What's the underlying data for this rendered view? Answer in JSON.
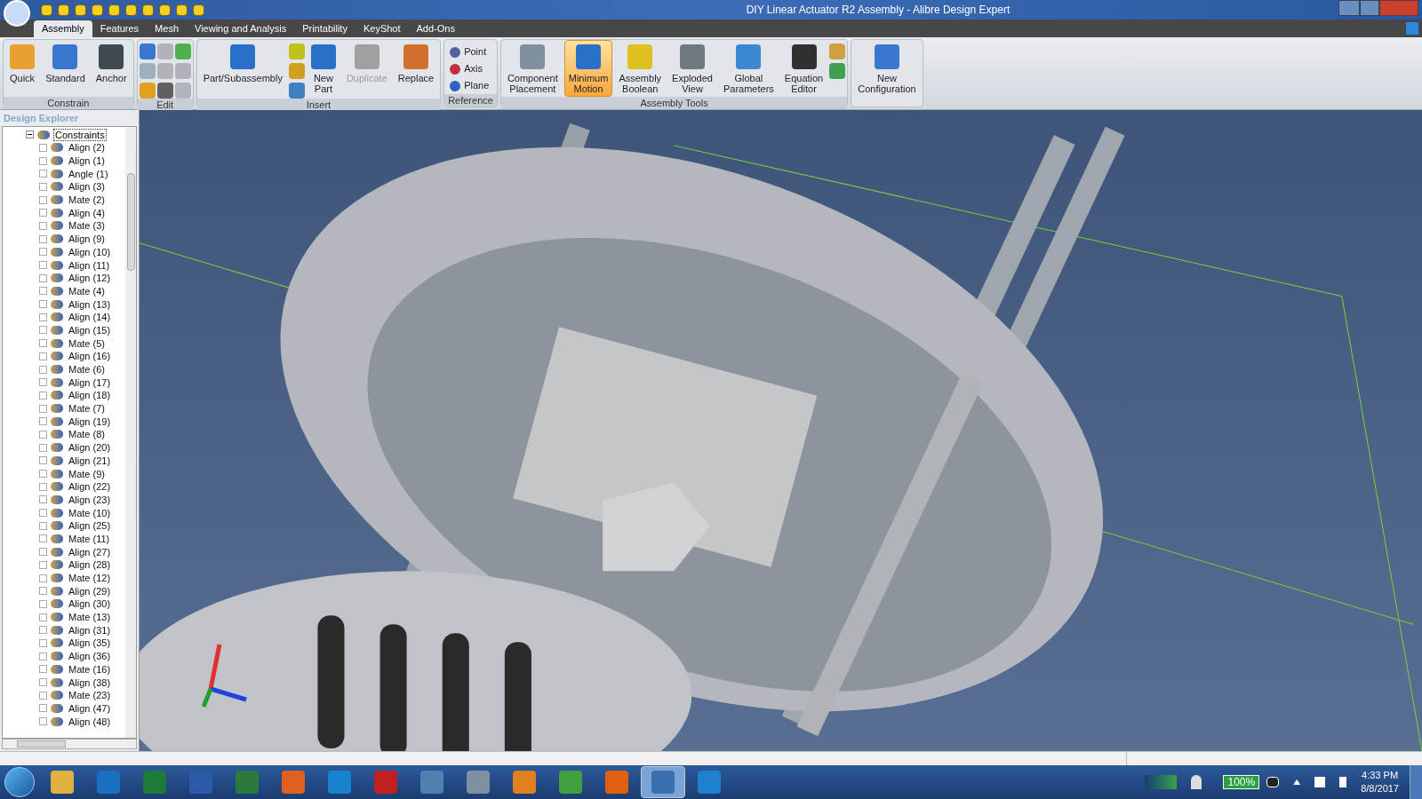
{
  "window": {
    "title": "DIY Linear Actuator R2 Assembly - Alibre Design Expert"
  },
  "tabs": [
    {
      "label": "Assembly",
      "selected": true
    },
    {
      "label": "Features",
      "selected": false
    },
    {
      "label": "Mesh",
      "selected": false
    },
    {
      "label": "Viewing and Analysis",
      "selected": false
    },
    {
      "label": "Printability",
      "selected": false
    },
    {
      "label": "KeyShot",
      "selected": false
    },
    {
      "label": "Add-Ons",
      "selected": false
    }
  ],
  "ribbon_groups": [
    {
      "title": "Constrain",
      "buttons": [
        {
          "kind": "large",
          "label": "Quick",
          "color": "#e8a030",
          "selected": false,
          "disabled": false
        },
        {
          "kind": "large",
          "label": "Standard",
          "color": "#3a78d0",
          "selected": false,
          "disabled": false
        },
        {
          "kind": "large",
          "label": "Anchor",
          "color": "#404850",
          "selected": false,
          "disabled": false
        }
      ]
    },
    {
      "title": "Edit",
      "buttons": [
        {
          "kind": "icon",
          "color": "#3a78d0"
        },
        {
          "kind": "icon",
          "color": "#a0b0c0"
        },
        {
          "kind": "icon",
          "color": "#e0a020"
        },
        {
          "kind": "icon",
          "color": "#b0b4b8"
        },
        {
          "kind": "icon",
          "color": "#b0b4b9"
        },
        {
          "kind": "icon",
          "color": "#606060"
        },
        {
          "kind": "icon",
          "color": "#50b050"
        },
        {
          "kind": "icon",
          "color": "#b0b4ba"
        },
        {
          "kind": "icon",
          "color": "#b0b4bb"
        }
      ]
    },
    {
      "title": "Insert",
      "buttons": [
        {
          "kind": "large",
          "label": "Part/Subassembly",
          "color": "#2a70c8",
          "selected": false,
          "disabled": false
        },
        {
          "kind": "icon",
          "color": "#c0c020"
        },
        {
          "kind": "icon",
          "color": "#d0a020"
        },
        {
          "kind": "icon",
          "color": "#4080c0"
        },
        {
          "kind": "large",
          "label": "New Part",
          "color": "#2a70c8",
          "selected": false,
          "disabled": false
        },
        {
          "kind": "large",
          "label": "Duplicate",
          "color": "#a0a0a0",
          "selected": false,
          "disabled": true
        },
        {
          "kind": "large",
          "label": "Replace",
          "color": "#d07030",
          "selected": false,
          "disabled": false
        }
      ]
    },
    {
      "title": "Reference",
      "buttons": [
        {
          "kind": "small",
          "label": "Point",
          "color": "#5060a0",
          "disabled": false
        },
        {
          "kind": "small",
          "label": "Axis",
          "color": "#c03040",
          "disabled": false
        },
        {
          "kind": "small",
          "label": "Plane",
          "color": "#3060c0",
          "disabled": false
        }
      ]
    },
    {
      "title": "Assembly Tools",
      "buttons": [
        {
          "kind": "large",
          "label": "Component Placement",
          "color": "#8090a0",
          "selected": false,
          "disabled": false
        },
        {
          "kind": "large",
          "label": "Minimum Motion",
          "color": "#2a70c8",
          "selected": true,
          "disabled": false
        },
        {
          "kind": "large",
          "label": "Assembly Boolean",
          "color": "#e0c020",
          "selected": false,
          "disabled": false
        },
        {
          "kind": "large",
          "label": "Exploded View",
          "color": "#707880",
          "selected": false,
          "disabled": false
        },
        {
          "kind": "large",
          "label": "Global Parameters",
          "color": "#3a88d0",
          "selected": false,
          "disabled": false
        },
        {
          "kind": "large",
          "label": "Equation Editor",
          "color": "#303030",
          "selected": false,
          "disabled": false
        },
        {
          "kind": "icon",
          "color": "#d0a040"
        },
        {
          "kind": "icon",
          "color": "#40a050"
        }
      ]
    },
    {
      "buttons": [
        {
          "kind": "large",
          "label": "New Configuration",
          "color": "#3a78d0",
          "selected": false,
          "disabled": false
        }
      ]
    }
  ],
  "design_explorer": {
    "title": "Design Explorer",
    "root": {
      "label": "Constraints",
      "selected": true,
      "expanded": true,
      "children": [
        {
          "label": "Align (2)",
          "selected": false
        },
        {
          "label": "Align (1)",
          "selected": false
        },
        {
          "label": "Angle (1)",
          "selected": false
        },
        {
          "label": "Align (3)",
          "selected": false
        },
        {
          "label": "Mate (2)",
          "selected": false
        },
        {
          "label": "Align (4)",
          "selected": false
        },
        {
          "label": "Mate (3)",
          "selected": false
        },
        {
          "label": "Align (9)",
          "selected": false
        },
        {
          "label": "Align (10)",
          "selected": false
        },
        {
          "label": "Align (11)",
          "selected": false
        },
        {
          "label": "Align (12)",
          "selected": false
        },
        {
          "label": "Mate (4)",
          "selected": false
        },
        {
          "label": "Align (13)",
          "selected": false
        },
        {
          "label": "Align (14)",
          "selected": false
        },
        {
          "label": "Align (15)",
          "selected": false
        },
        {
          "label": "Mate (5)",
          "selected": false
        },
        {
          "label": "Align (16)",
          "selected": false
        },
        {
          "label": "Mate (6)",
          "selected": false
        },
        {
          "label": "Align (17)",
          "selected": false
        },
        {
          "label": "Align (18)",
          "selected": false
        },
        {
          "label": "Mate (7)",
          "selected": false
        },
        {
          "label": "Align (19)",
          "selected": false
        },
        {
          "label": "Mate (8)",
          "selected": false
        },
        {
          "label": "Align (20)",
          "selected": false
        },
        {
          "label": "Align (21)",
          "selected": false
        },
        {
          "label": "Mate (9)",
          "selected": false
        },
        {
          "label": "Align (22)",
          "selected": false
        },
        {
          "label": "Align (23)",
          "selected": false
        },
        {
          "label": "Mate (10)",
          "selected": false
        },
        {
          "label": "Align (25)",
          "selected": false
        },
        {
          "label": "Mate (11)",
          "selected": false
        },
        {
          "label": "Align (27)",
          "selected": false
        },
        {
          "label": "Align (28)",
          "selected": false
        },
        {
          "label": "Mate (12)",
          "selected": false
        },
        {
          "label": "Align (29)",
          "selected": false
        },
        {
          "label": "Align (30)",
          "selected": false
        },
        {
          "label": "Mate (13)",
          "selected": false
        },
        {
          "label": "Align (31)",
          "selected": false
        },
        {
          "label": "Align (35)",
          "selected": false
        },
        {
          "label": "Align (36)",
          "selected": false
        },
        {
          "label": "Mate (16)",
          "selected": false
        },
        {
          "label": "Align (38)",
          "selected": false
        },
        {
          "label": "Mate (23)",
          "selected": false
        },
        {
          "label": "Align (47)",
          "selected": false
        },
        {
          "label": "Align (48)",
          "selected": false
        }
      ]
    }
  },
  "taskbar": {
    "apps": [
      {
        "color": "#e0b040",
        "selected": false
      },
      {
        "color": "#1a70c0",
        "selected": false
      },
      {
        "color": "#1d7a3a",
        "selected": false
      },
      {
        "color": "#2a5aa8",
        "selected": false
      },
      {
        "color": "#2a7a40",
        "selected": false
      },
      {
        "color": "#e06020",
        "selected": false
      },
      {
        "color": "#1a80d0",
        "selected": false
      },
      {
        "color": "#c02020",
        "selected": false
      },
      {
        "color": "#5080b0",
        "selected": false
      },
      {
        "color": "#8090a0",
        "selected": false
      },
      {
        "color": "#e08020",
        "selected": false
      },
      {
        "color": "#40a040",
        "selected": false
      },
      {
        "color": "#e06010",
        "selected": false
      },
      {
        "color": "#3a70b0",
        "selected": true
      },
      {
        "color": "#2080d0",
        "selected": false
      }
    ],
    "battery": "100%",
    "time": "4:33 PM",
    "date": "8/8/2017"
  }
}
